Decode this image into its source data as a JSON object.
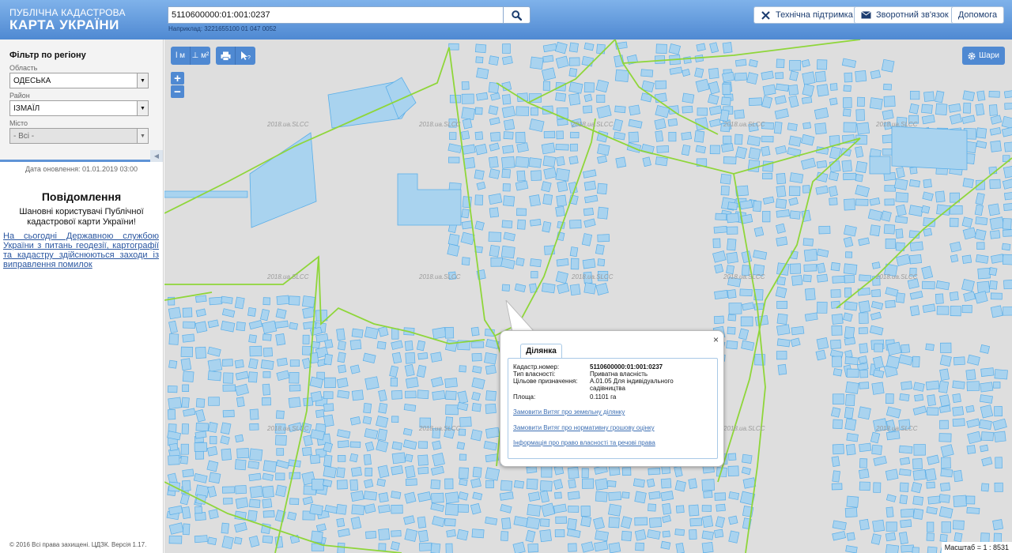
{
  "header": {
    "logo_line1": "ПУБЛІЧНА КАДАСТРОВА",
    "logo_line2": "КАРТА УКРАЇНИ",
    "search_value": "5110600000:01:001:0237",
    "search_hint": "Наприклад: 3221655100 01 047 0052",
    "support_label": "Технічна підтримка",
    "feedback_label": "Зворотний зв'язок",
    "help_label": "Допомога"
  },
  "sidebar": {
    "filter_title": "Фільтр по регіону",
    "region_label": "Область",
    "region_value": "ОДЕСЬКА",
    "district_label": "Район",
    "district_value": "ІЗМАЇЛ",
    "city_label": "Місто",
    "city_value": "- Всі -",
    "updated": "Дата оновлення: 01.01.2019 03:00",
    "notice_title": "Повідомлення",
    "notice_text": "Шановні користувачі Публічної кадастрової карти України!",
    "notice_link": "На сьогодні Державною службою України з питань геодезії, картографії та кадастру здійснюються заходи із виправлення помилок",
    "copyright": "© 2016 Всі права захищені. ЦДЗК. Версія 1.17."
  },
  "map": {
    "tools": [
      "l м",
      "⊥ м²",
      "print",
      "info"
    ],
    "zoom_in": "+",
    "zoom_out": "−",
    "layers_label": "Шари",
    "scale": "Масштаб = 1 : 8531",
    "watermark": "2018.ua.SLCC",
    "colors": {
      "background": "#dedede",
      "parcel_fill": "#a9d3ef",
      "parcel_stroke": "#5aaee8",
      "boundary": "#8fd63a"
    }
  },
  "popup": {
    "tab": "Ділянка",
    "close": "×",
    "fields": [
      {
        "key": "Кадастр.номер:",
        "value": "5110600000:01:001:0237"
      },
      {
        "key": "Тип власності:",
        "value": "Приватна власність"
      },
      {
        "key": "Цільове призначення:",
        "value": "А.01.05 Для індивідуального садівництва"
      },
      {
        "key": "Площа:",
        "value": "0.1101 га"
      }
    ],
    "links": [
      "Замовити Витяг про земельну ділянку",
      "Замовити Витяг про нормативну грошову оцінку",
      "Інформація про право власності та речові права"
    ]
  }
}
